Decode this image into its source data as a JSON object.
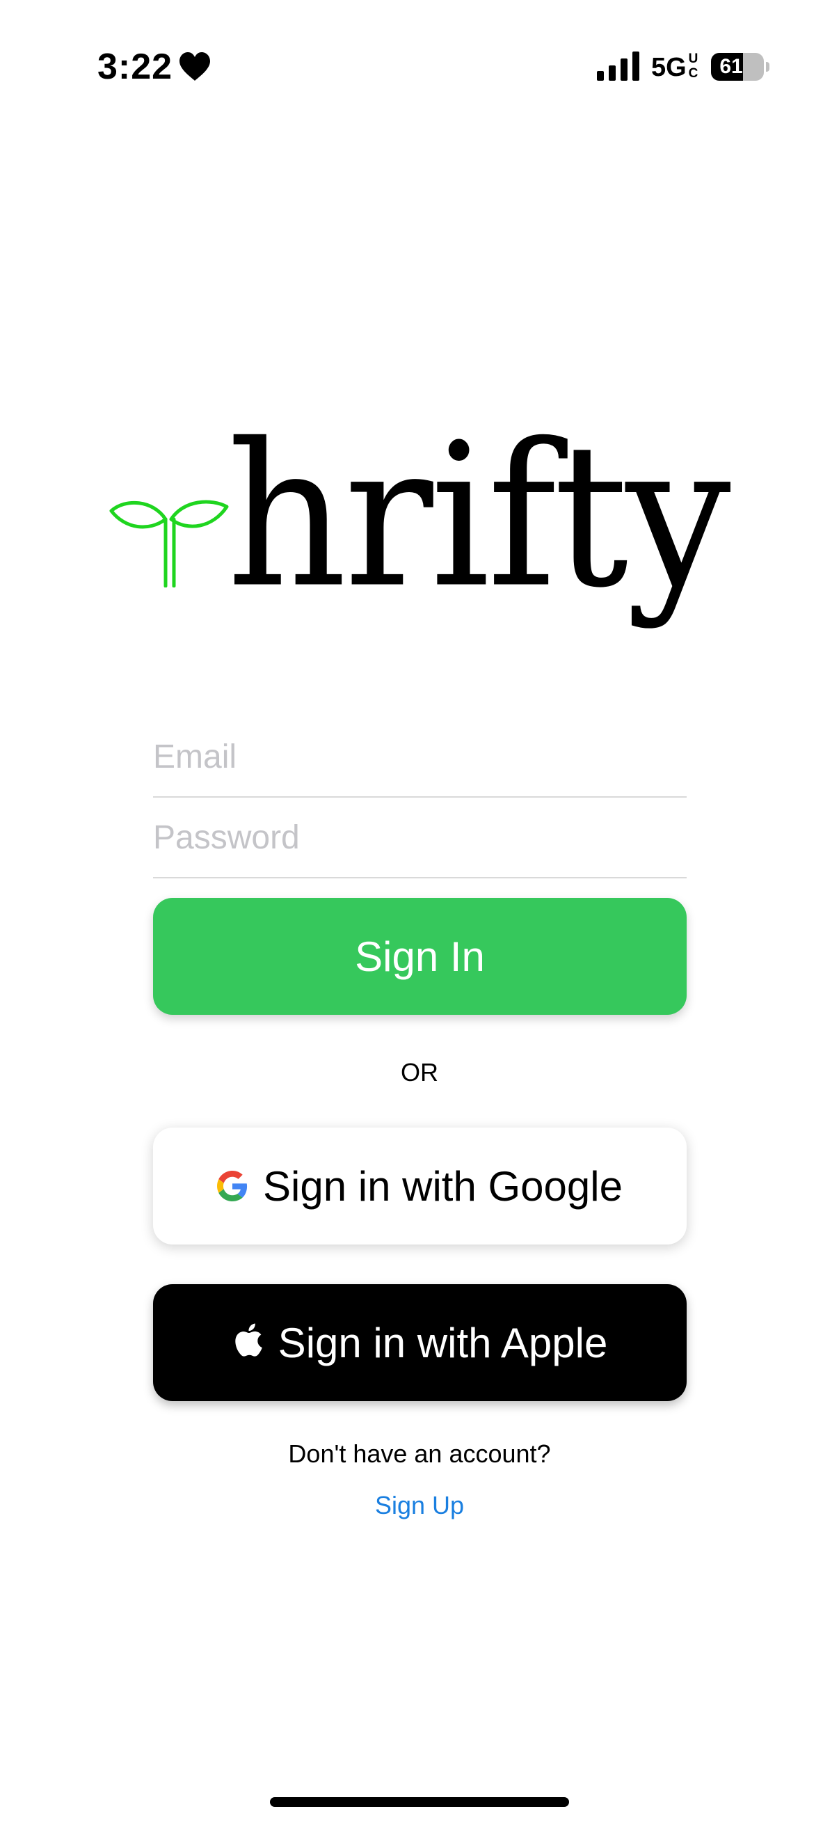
{
  "status_bar": {
    "time": "3:22",
    "network": "5G",
    "network_superscript": "UC",
    "battery_level": "61",
    "battery_fraction": 0.61
  },
  "logo": {
    "text": "hrifty",
    "sprout_color": "#1fd51f"
  },
  "form": {
    "email_placeholder": "Email",
    "password_placeholder": "Password",
    "email_value": "",
    "password_value": ""
  },
  "buttons": {
    "sign_in_label": "Sign In",
    "sign_in_color": "#36c85c",
    "or_label": "OR",
    "google_label": "Sign in with Google",
    "apple_label": "Sign in with Apple"
  },
  "footer": {
    "no_account_text": "Don't have an account?",
    "sign_up_label": "Sign Up",
    "link_color": "#1a7fe0"
  },
  "icons": {
    "status": [
      "heart-icon",
      "signal-icon",
      "battery-icon"
    ],
    "buttons": [
      "google-icon",
      "apple-icon"
    ],
    "logo": "sprout-icon"
  }
}
